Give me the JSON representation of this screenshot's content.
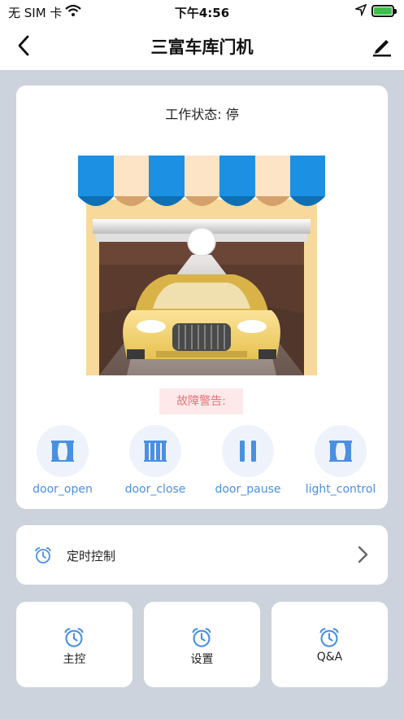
{
  "status_bar": {
    "carrier": "无 SIM 卡",
    "time": "下午4:56"
  },
  "nav": {
    "title": "三富车库门机"
  },
  "device": {
    "work_status": "工作状态: 停",
    "fault_warning": "故障警告:"
  },
  "controls": [
    {
      "label": "door_open",
      "icon": "curtain-open-icon"
    },
    {
      "label": "door_close",
      "icon": "curtain-closed-icon"
    },
    {
      "label": "door_pause",
      "icon": "pause-icon"
    },
    {
      "label": "light_control",
      "icon": "curtain-open-icon"
    }
  ],
  "timer": {
    "label": "定时控制"
  },
  "tiles": [
    {
      "label": "主控",
      "icon": "alarm-clock-icon"
    },
    {
      "label": "设置",
      "icon": "alarm-clock-icon"
    },
    {
      "label": "Q&A",
      "icon": "alarm-clock-icon"
    }
  ],
  "colors": {
    "accent": "#4a90e2",
    "background": "#ccd3dc",
    "warning_text": "#e8737a",
    "warning_bg": "#fde9ea",
    "battery": "#3cc04a"
  }
}
